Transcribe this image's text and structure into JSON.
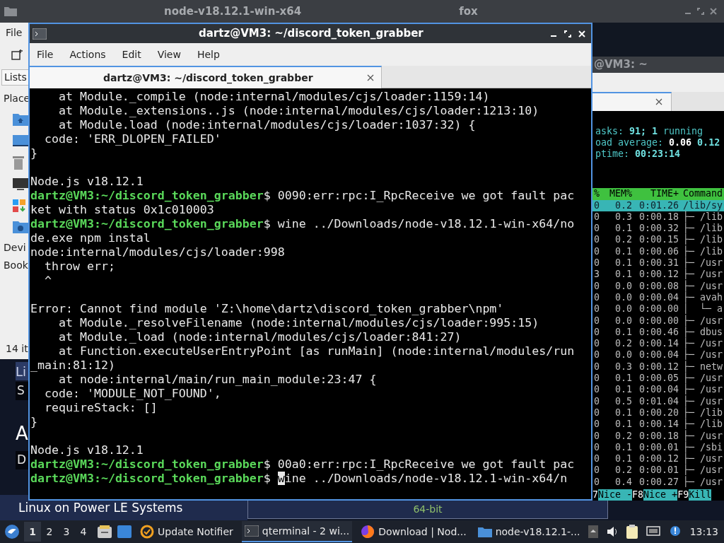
{
  "background_titlebar": {
    "title": "node-v18.12.1-win-x64",
    "title_2": "fox"
  },
  "file_manager": {
    "menu": "File",
    "tab": "Lists",
    "section_1": "Place",
    "section_2": "Devi",
    "section_3": "Book",
    "status": "14 it"
  },
  "browser": {
    "items": [
      {
        "kind": "header",
        "text": "Li"
      },
      {
        "kind": "box",
        "text": "S"
      },
      {
        "kind": "heading",
        "text": "A"
      },
      {
        "kind": "box",
        "text": "D"
      }
    ],
    "row_label": "Linux on Power LE Systems",
    "row_value": "64-bit"
  },
  "terminal": {
    "title": "dartz@VM3: ~/discord_token_grabber",
    "menu": [
      "File",
      "Actions",
      "Edit",
      "View",
      "Help"
    ],
    "tab": "dartz@VM3: ~/discord_token_grabber",
    "lines": [
      {
        "kind": "output",
        "text": "    at Module._compile (node:internal/modules/cjs/loader:1159:14)"
      },
      {
        "kind": "output",
        "text": "    at Module._extensions..js (node:internal/modules/cjs/loader:1213:10)"
      },
      {
        "kind": "output",
        "text": "    at Module.load (node:internal/modules/cjs/loader:1037:32) {"
      },
      {
        "kind": "output",
        "text": "  code: 'ERR_DLOPEN_FAILED'"
      },
      {
        "kind": "output",
        "text": "}"
      },
      {
        "kind": "blank"
      },
      {
        "kind": "output",
        "text": "Node.js v18.12.1"
      },
      {
        "kind": "prompt",
        "prompt": "dartz@VM3:~/discord_token_grabber",
        "sign": "$",
        "text": "0090:err:rpc:I_RpcReceive we got fault pac",
        "cursor": false
      },
      {
        "kind": "output",
        "text": "ket with status 0x1c010003"
      },
      {
        "kind": "prompt",
        "prompt": "dartz@VM3:~/discord_token_grabber",
        "sign": "$",
        "text": "wine ../Downloads/node-v18.12.1-win-x64/no",
        "cursor": false
      },
      {
        "kind": "output",
        "text": "de.exe npm instal"
      },
      {
        "kind": "output",
        "text": "node:internal/modules/cjs/loader:998"
      },
      {
        "kind": "output",
        "text": "  throw err;"
      },
      {
        "kind": "output",
        "text": "  ^"
      },
      {
        "kind": "blank"
      },
      {
        "kind": "output",
        "text": "Error: Cannot find module 'Z:\\home\\dartz\\discord_token_grabber\\npm'"
      },
      {
        "kind": "output",
        "text": "    at Module._resolveFilename (node:internal/modules/cjs/loader:995:15)"
      },
      {
        "kind": "output",
        "text": "    at Module._load (node:internal/modules/cjs/loader:841:27)"
      },
      {
        "kind": "output",
        "text": "    at Function.executeUserEntryPoint [as runMain] (node:internal/modules/run"
      },
      {
        "kind": "output",
        "text": "_main:81:12)"
      },
      {
        "kind": "output",
        "text": "    at node:internal/main/run_main_module:23:47 {"
      },
      {
        "kind": "output",
        "text": "  code: 'MODULE_NOT_FOUND',"
      },
      {
        "kind": "output",
        "text": "  requireStack: []"
      },
      {
        "kind": "output",
        "text": "}"
      },
      {
        "kind": "blank"
      },
      {
        "kind": "output",
        "text": "Node.js v18.12.1"
      },
      {
        "kind": "prompt",
        "prompt": "dartz@VM3:~/discord_token_grabber",
        "sign": "$",
        "text": "00a0:err:rpc:I_RpcReceive we got fault pac",
        "cursor": false
      },
      {
        "kind": "prompt",
        "prompt": "dartz@VM3:~/discord_token_grabber",
        "sign": "$",
        "text": "wine ../Downloads/node-v18.12.1-win-x64/n",
        "cursor": true
      }
    ]
  },
  "htop": {
    "title": "@VM3: ~",
    "summary": [
      {
        "label": "asks: ",
        "value": "91; 1",
        "suffix": " running"
      },
      {
        "label": "oad average: ",
        "value": "0.06",
        "suffix": " 0.12"
      },
      {
        "label": "ptime: ",
        "value": "00:23:14"
      }
    ],
    "columns": [
      "%",
      "MEM%",
      "TIME+",
      "Command"
    ],
    "rows": [
      {
        "cpu": "0",
        "mem": "0.2",
        "time": "0:01.26",
        "command": "/lib/sy",
        "selected": true
      },
      {
        "cpu": "0",
        "mem": "0.3",
        "time": "0:00.18",
        "command": "├─ /lib",
        "selected": false
      },
      {
        "cpu": "0",
        "mem": "0.1",
        "time": "0:00.32",
        "command": "├─ /lib",
        "selected": false
      },
      {
        "cpu": "0",
        "mem": "0.2",
        "time": "0:00.15",
        "command": "├─ /lib",
        "selected": false
      },
      {
        "cpu": "0",
        "mem": "0.1",
        "time": "0:00.06",
        "command": "├─ /lib",
        "selected": false
      },
      {
        "cpu": "0",
        "mem": "0.1",
        "time": "0:00.31",
        "command": "├─ /usr",
        "selected": false
      },
      {
        "cpu": "3",
        "mem": "0.1",
        "time": "0:00.12",
        "command": "├─ /usr",
        "selected": false
      },
      {
        "cpu": "0",
        "mem": "0.0",
        "time": "0:00.08",
        "command": "├─ /usr",
        "selected": false
      },
      {
        "cpu": "0",
        "mem": "0.0",
        "time": "0:00.04",
        "command": "├─ avah",
        "selected": false
      },
      {
        "cpu": "0",
        "mem": "0.0",
        "time": "0:00.00",
        "command": "│  └─ a",
        "selected": false
      },
      {
        "cpu": "0",
        "mem": "0.0",
        "time": "0:00.00",
        "command": "├─ /usr",
        "selected": false
      },
      {
        "cpu": "0",
        "mem": "0.1",
        "time": "0:00.46",
        "command": "├─ dbus",
        "selected": false
      },
      {
        "cpu": "0",
        "mem": "0.2",
        "time": "0:00.14",
        "command": "├─ /usr",
        "selected": false
      },
      {
        "cpu": "0",
        "mem": "0.0",
        "time": "0:00.04",
        "command": "├─ /usr",
        "selected": false
      },
      {
        "cpu": "0",
        "mem": "0.3",
        "time": "0:00.12",
        "command": "├─ netw",
        "selected": false
      },
      {
        "cpu": "0",
        "mem": "0.1",
        "time": "0:00.05",
        "command": "├─ /usr",
        "selected": false
      },
      {
        "cpu": "0",
        "mem": "0.1",
        "time": "0:00.04",
        "command": "├─ /usr",
        "selected": false
      },
      {
        "cpu": "0",
        "mem": "0.5",
        "time": "0:01.04",
        "command": "├─ /usr",
        "selected": false
      },
      {
        "cpu": "0",
        "mem": "0.1",
        "time": "0:00.20",
        "command": "├─ /lib",
        "selected": false
      },
      {
        "cpu": "0",
        "mem": "0.1",
        "time": "0:00.14",
        "command": "├─ /lib",
        "selected": false
      },
      {
        "cpu": "0",
        "mem": "0.2",
        "time": "0:00.18",
        "command": "├─ /usr",
        "selected": false
      },
      {
        "cpu": "0",
        "mem": "0.1",
        "time": "0:00.01",
        "command": "├─ /sbi",
        "selected": false
      },
      {
        "cpu": "0",
        "mem": "0.1",
        "time": "0:00.12",
        "command": "├─ /usr",
        "selected": false
      },
      {
        "cpu": "0",
        "mem": "0.2",
        "time": "0:00.01",
        "command": "├─ /usr",
        "selected": false
      },
      {
        "cpu": "0",
        "mem": "0.4",
        "time": "0:00.27",
        "command": "├─ /usr",
        "selected": false
      }
    ],
    "footer": [
      {
        "key": "7",
        "label": "Nice -"
      },
      {
        "key": "F8",
        "label": "Nice +"
      },
      {
        "key": "F9",
        "label": "Kill"
      }
    ]
  },
  "taskbar": {
    "workspaces": [
      {
        "label": "1",
        "selected": true
      },
      {
        "label": "2",
        "selected": false
      },
      {
        "label": "3",
        "selected": false
      },
      {
        "label": "4",
        "selected": false
      }
    ],
    "tasks": [
      {
        "kind": "updater",
        "label": "Update Notifier",
        "selected": false
      },
      {
        "kind": "terminal",
        "label": "qterminal - 2 wi...",
        "selected": true
      },
      {
        "kind": "browser",
        "label": "Download | Nod...",
        "selected": false
      },
      {
        "kind": "folder",
        "label": "node-v18.12.1-...",
        "selected": false
      }
    ],
    "clock": "13:13"
  }
}
